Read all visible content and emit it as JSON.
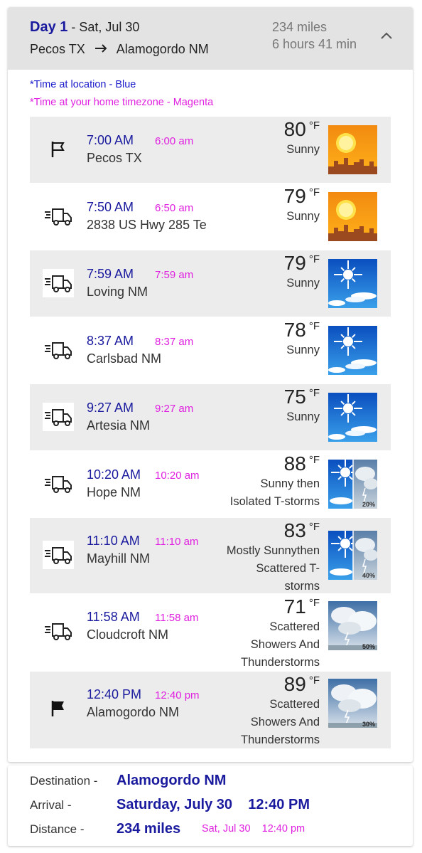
{
  "day": {
    "label": "Day 1",
    "date": " - Sat, Jul 30",
    "origin": "Pecos TX",
    "destination": "Alamogordo NM",
    "miles": "234 miles",
    "duration": "6 hours 41 min"
  },
  "legend": {
    "blue": "*Time at location - Blue",
    "magenta": "*Time at your home timezone - Magenta"
  },
  "stops": [
    {
      "icon": "start-flag-icon",
      "time": "7:00 AM",
      "home_time": "6:00 am",
      "place": "Pecos TX",
      "temp": "80",
      "unit": "°F",
      "cond": [
        "Sunny"
      ],
      "wx": "sunny-city"
    },
    {
      "icon": "truck-icon",
      "time": "7:50 AM",
      "home_time": "6:50 am",
      "place": "2838 US Hwy 285 Te",
      "temp": "79",
      "unit": "°F",
      "cond": [
        "Sunny"
      ],
      "wx": "sunny-city"
    },
    {
      "icon": "truck-icon",
      "time": "7:59 AM",
      "home_time": "7:59 am",
      "place": "Loving NM",
      "temp": "79",
      "unit": "°F",
      "cond": [
        "Sunny"
      ],
      "wx": "sunny-sky"
    },
    {
      "icon": "truck-icon",
      "time": "8:37 AM",
      "home_time": "8:37 am",
      "place": "Carlsbad NM",
      "temp": "78",
      "unit": "°F",
      "cond": [
        "Sunny"
      ],
      "wx": "sunny-sky"
    },
    {
      "icon": "truck-icon",
      "time": "9:27 AM",
      "home_time": "9:27 am",
      "place": "Artesia NM",
      "temp": "75",
      "unit": "°F",
      "cond": [
        "Sunny"
      ],
      "wx": "sunny-sky"
    },
    {
      "icon": "truck-icon",
      "time": "10:20 AM",
      "home_time": "10:20 am",
      "place": "Hope NM",
      "temp": "88",
      "unit": "°F",
      "cond": [
        "Sunny then",
        "Isolated T-storms"
      ],
      "wx": "split",
      "pct": "20%"
    },
    {
      "icon": "truck-icon",
      "time": "11:10 AM",
      "home_time": "11:10 am",
      "place": "Mayhill NM",
      "temp": "83",
      "unit": "°F",
      "cond": [
        "Mostly Sunnythen",
        "Scattered T-",
        "storms"
      ],
      "wx": "split",
      "pct": "40%"
    },
    {
      "icon": "truck-icon",
      "time": "11:58 AM",
      "home_time": "11:58 am",
      "place": "Cloudcroft NM",
      "temp": "71",
      "unit": "°F",
      "cond": [
        "Scattered",
        "Showers And",
        "Thunderstorms"
      ],
      "wx": "storm",
      "pct": "50%"
    },
    {
      "icon": "finish-flag-icon",
      "time": "12:40 PM",
      "home_time": "12:40 pm",
      "place": "Alamogordo NM",
      "temp": "89",
      "unit": "°F",
      "cond": [
        "Scattered",
        "Showers And",
        "Thunderstorms"
      ],
      "wx": "storm",
      "pct": "30%"
    }
  ],
  "summary": {
    "destination_label": "Destination -",
    "destination_value": "Alamogordo NM",
    "arrival_label": "Arrival -",
    "arrival_value": "Saturday, July 30    12:40 PM",
    "distance_label": "Distance -",
    "distance_value": "234 miles",
    "home_arrival": "Sat, Jul 30    12:40 pm"
  },
  "colors": {
    "location_time": "#1a1a9e",
    "home_time": "#e020e0",
    "row_shade": "#ececec",
    "header_bg": "#e3e3e3"
  }
}
